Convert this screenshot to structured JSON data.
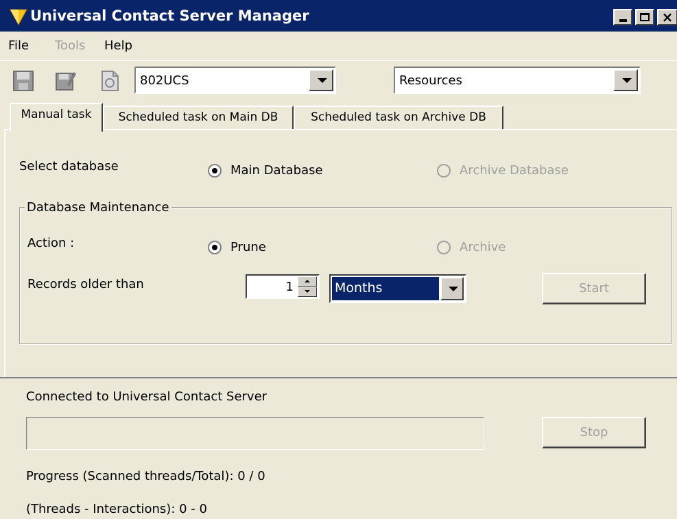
{
  "window": {
    "title": "Universal Contact Server Manager",
    "title_bar_color": "#0a246a"
  },
  "menu": {
    "items": [
      {
        "label": "File",
        "enabled": true
      },
      {
        "label": "Tools",
        "enabled": false
      },
      {
        "label": "Help",
        "enabled": true
      }
    ]
  },
  "toolbar": {
    "icons": [
      "save-icon",
      "edit-icon",
      "refresh-icon"
    ],
    "server_combo_value": "802UCS",
    "category_combo_value": "Resources"
  },
  "tabs": [
    {
      "label": "Manual task",
      "active": true
    },
    {
      "label": "Scheduled task on Main DB",
      "active": false
    },
    {
      "label": "Scheduled task on Archive DB",
      "active": false
    }
  ],
  "manual": {
    "select_database_label": "Select database",
    "db_options": [
      {
        "label": "Main Database",
        "selected": true,
        "enabled": true
      },
      {
        "label": "Archive Database",
        "selected": false,
        "enabled": false
      }
    ],
    "group_title": "Database Maintenance",
    "action_label": "Action :",
    "action_options": [
      {
        "label": "Prune",
        "selected": true,
        "enabled": true
      },
      {
        "label": "Archive",
        "selected": false,
        "enabled": false
      }
    ],
    "records_label": "Records older than",
    "records_value": "1",
    "units_value": "Months",
    "start_label": "Start"
  },
  "status": {
    "connection_text": "Connected to Universal Contact Server",
    "progress_fraction": 0,
    "stop_label": "Stop",
    "progress_text": "Progress (Scanned threads/Total): 0 / 0",
    "threads_text": "(Threads - Interactions): 0 - 0"
  }
}
